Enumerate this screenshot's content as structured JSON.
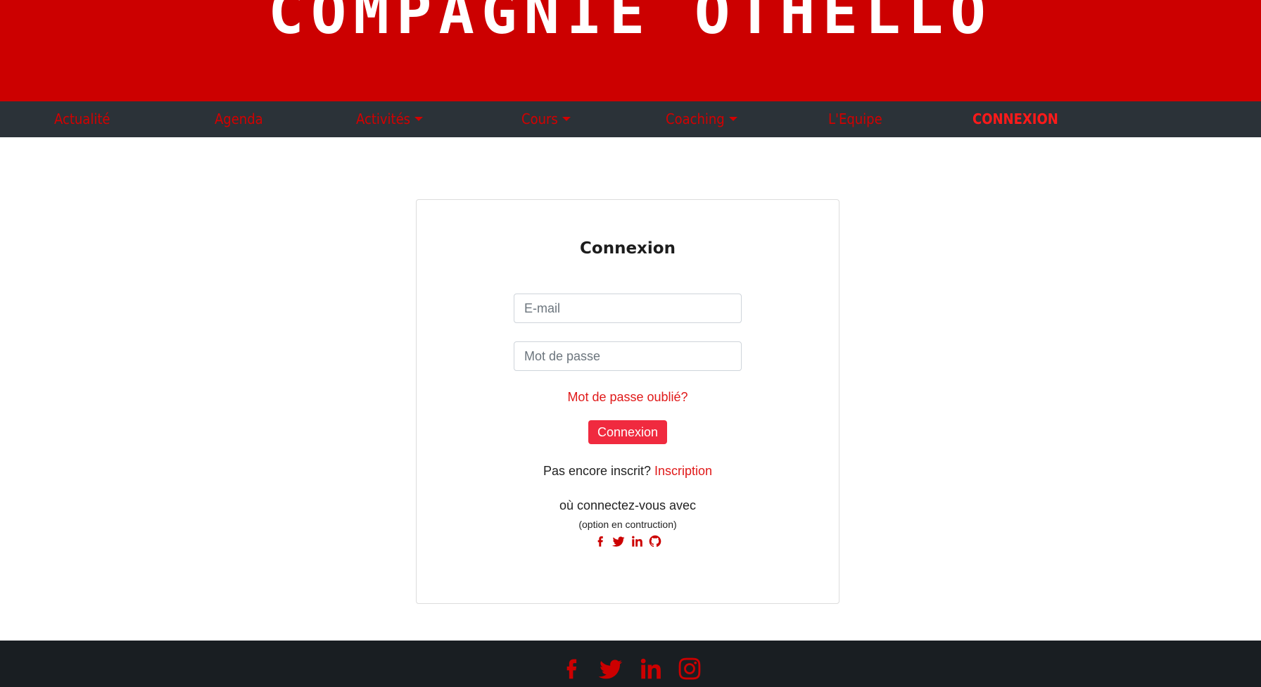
{
  "banner": {
    "title": "COMPAGNIE OTHELLO"
  },
  "nav": {
    "items": [
      {
        "label": "Actualité",
        "dropdown": false
      },
      {
        "label": "Agenda",
        "dropdown": false
      },
      {
        "label": "Activités",
        "dropdown": true
      },
      {
        "label": "Cours",
        "dropdown": true
      },
      {
        "label": "Coaching",
        "dropdown": true
      },
      {
        "label": "L'Equipe",
        "dropdown": false
      },
      {
        "label": "CONNEXION",
        "dropdown": false,
        "active": true
      }
    ]
  },
  "login": {
    "title": "Connexion",
    "email_placeholder": "E-mail",
    "password_placeholder": "Mot de passe",
    "forgot_label": "Mot de passe oublié?",
    "submit_label": "Connexion",
    "signup_prompt": "Pas encore inscrit? ",
    "signup_link": "Inscription",
    "connect_with": "où connectez-vous avec",
    "option_note": "(option en contruction)",
    "social_icons": [
      "facebook-icon",
      "twitter-icon",
      "linkedin-icon",
      "github-icon"
    ]
  },
  "footer": {
    "social_icons": [
      "facebook-icon",
      "twitter-icon",
      "linkedin-icon",
      "instagram-icon"
    ]
  },
  "colors": {
    "brand_red": "#cc0000",
    "nav_bg": "#2b3238",
    "nav_text": "#d40000",
    "button_red": "#f02a3f",
    "footer_bg": "#191e22"
  }
}
